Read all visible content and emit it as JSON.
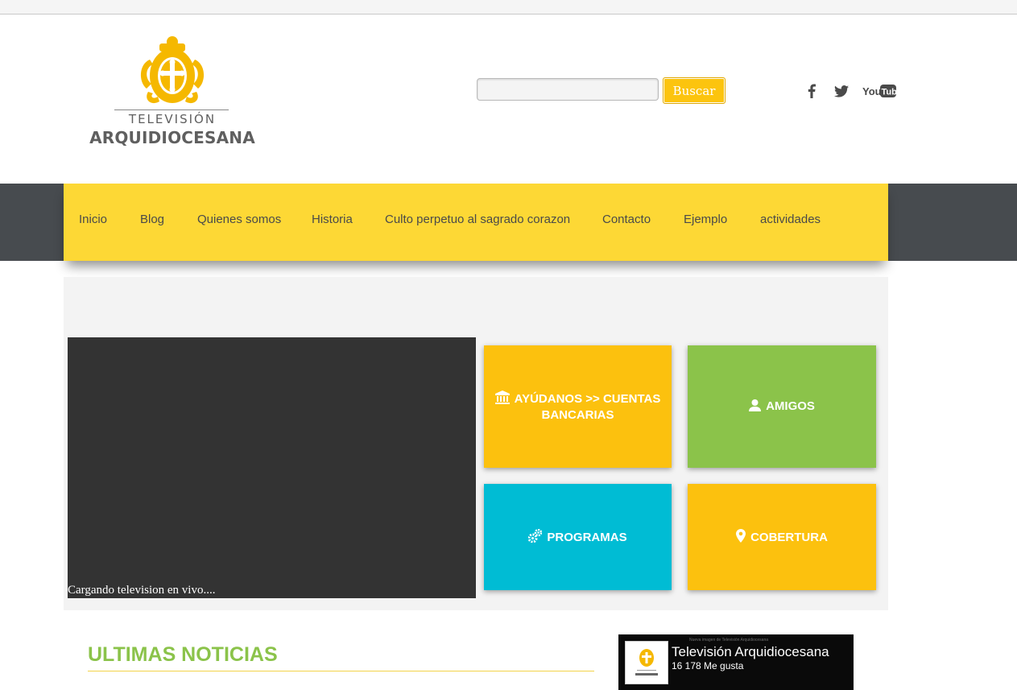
{
  "header": {
    "logo_line1": "TELEVISIÓN",
    "logo_line2": "ARQUIDIOCESANA",
    "search_placeholder": "",
    "search_button": "Buscar",
    "social": [
      "facebook-icon",
      "twitter-icon",
      "youtube-icon"
    ]
  },
  "nav": {
    "items": [
      "Inicio",
      "Blog",
      "Quienes somos",
      "Historia",
      "Culto perpetuo al sagrado corazon",
      "Contacto",
      "Ejemplo",
      "actividades"
    ]
  },
  "video": {
    "status_text": "Cargando television en vivo...."
  },
  "tiles": {
    "ayuda": "AYÚDANOS >> CUENTAS BANCARIAS",
    "amigos": "AMIGOS",
    "programas": "PROGRAMAS",
    "cobertura": "COBERTURA"
  },
  "news": {
    "title": "ULTIMAS NOTICIAS"
  },
  "facebook": {
    "page_name": "Televisión Arquidiocesana",
    "likes": "16 178 Me gusta",
    "cover_text": "Nueva imagen de Televisión Arquidiocesana"
  },
  "colors": {
    "nav_yellow": "#fdd835",
    "tile_yellow": "#fcc10e",
    "tile_green": "#8bc34a",
    "tile_cyan": "#00bcd4",
    "nav_dark": "#474b4f",
    "logo_gold": "#f5b800"
  }
}
